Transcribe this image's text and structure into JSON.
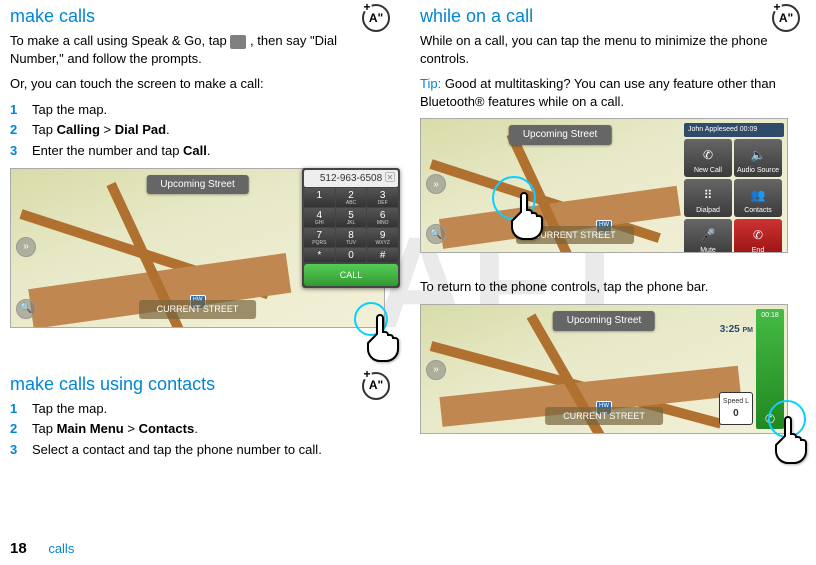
{
  "watermark": "DRAFT",
  "left": {
    "heading1": "make calls",
    "para1a": "To make a call using Speak & Go, tap ",
    "para1b": ", then say \"Dial Number,\" and follow the prompts.",
    "para2": "Or, you can touch the screen to make a call:",
    "steps1": {
      "s1": "Tap the map.",
      "s2a": "Tap ",
      "s2b": "Calling",
      "s2c": " > ",
      "s2d": "Dial Pad",
      "s2e": ".",
      "s3a": "Enter the number and tap ",
      "s3b": "Call",
      "s3c": "."
    },
    "heading2": "make calls using contacts",
    "steps2": {
      "s1": "Tap the map.",
      "s2a": "Tap ",
      "s2b": "Main Menu",
      "s2c": " > ",
      "s2d": "Contacts",
      "s2e": ".",
      "s3": "Select a contact and tap the phone number to call."
    }
  },
  "right": {
    "heading1": "while on a call",
    "para1": "While on a call, you can tap the menu to minimize the phone controls.",
    "tip_label": "Tip:",
    "tip_text": " Good at multitasking? You can use any feature other than Bluetooth® features while on a call.",
    "para2": "To return to the phone controls, tap the phone bar."
  },
  "badge": "A\"",
  "fig_common": {
    "upcoming": "Upcoming Street",
    "current": "CURRENT STREET",
    "shield": "HW"
  },
  "fig1": {
    "dialed": "512-963-6508",
    "keys": [
      {
        "n": "1",
        "s": ""
      },
      {
        "n": "2",
        "s": "ABC"
      },
      {
        "n": "3",
        "s": "DEF"
      },
      {
        "n": "4",
        "s": "GHI"
      },
      {
        "n": "5",
        "s": "JKL"
      },
      {
        "n": "6",
        "s": "MNO"
      },
      {
        "n": "7",
        "s": "PQRS"
      },
      {
        "n": "8",
        "s": "TUV"
      },
      {
        "n": "9",
        "s": "WXYZ"
      },
      {
        "n": "*",
        "s": ""
      },
      {
        "n": "0",
        "s": ""
      },
      {
        "n": "#",
        "s": ""
      }
    ],
    "call": "CALL"
  },
  "fig2": {
    "caller": "John Appleseed 00:09",
    "btns": [
      "New Call",
      "Audio Source",
      "Dialpad",
      "Contacts",
      "Mute",
      "End"
    ]
  },
  "fig3": {
    "phonebar_time": "00:18",
    "clock": "3:25",
    "ampm": "PM",
    "speed_label": "Speed L",
    "speed_val": "0"
  },
  "footer": {
    "page": "18",
    "section": "calls"
  }
}
